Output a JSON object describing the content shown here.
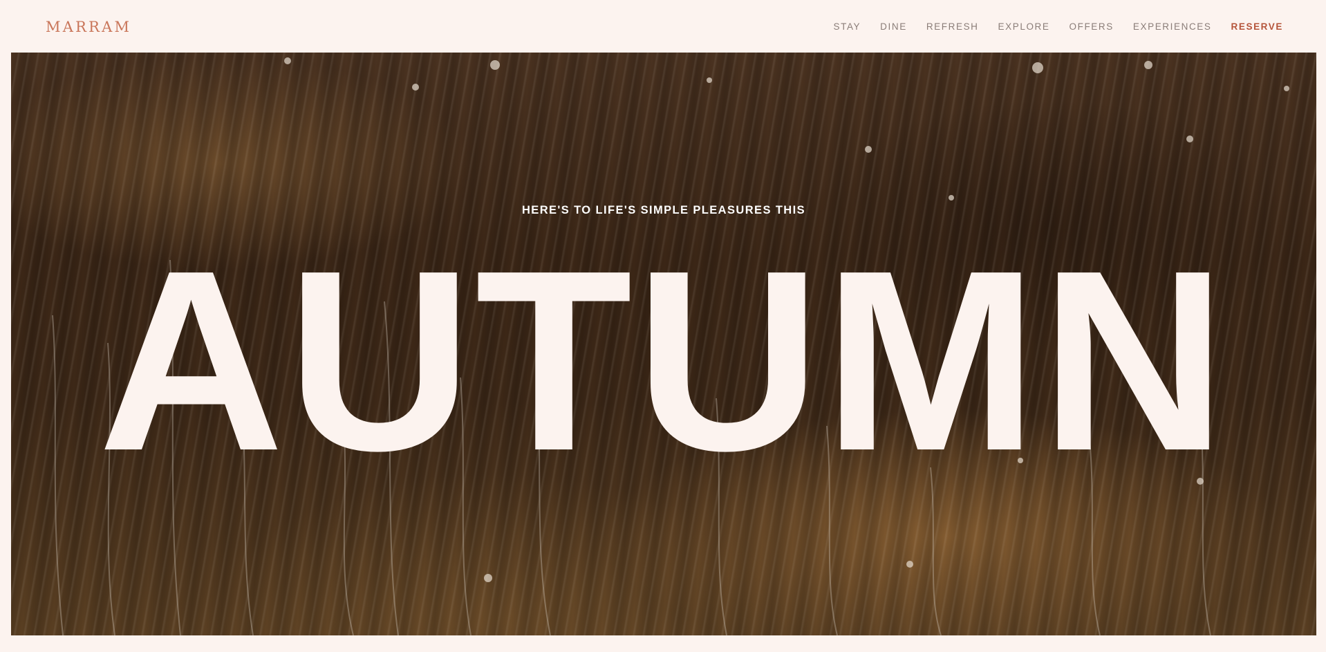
{
  "brand": {
    "logo_text": "MARRAM"
  },
  "nav": {
    "items": [
      {
        "label": "STAY"
      },
      {
        "label": "DINE"
      },
      {
        "label": "REFRESH"
      },
      {
        "label": "EXPLORE"
      },
      {
        "label": "OFFERS"
      },
      {
        "label": "EXPERIENCES"
      }
    ],
    "reserve_label": "RESERVE"
  },
  "hero": {
    "eyebrow": "HERE'S TO LIFE'S SIMPLE PLEASURES THIS",
    "headline": "AUTUMN"
  },
  "colors": {
    "background": "#fcf3ef",
    "logo": "#c9765a",
    "nav_text": "#8a7d78",
    "reserve_accent": "#b5543a",
    "headline_fill": "#fcf3ef"
  }
}
